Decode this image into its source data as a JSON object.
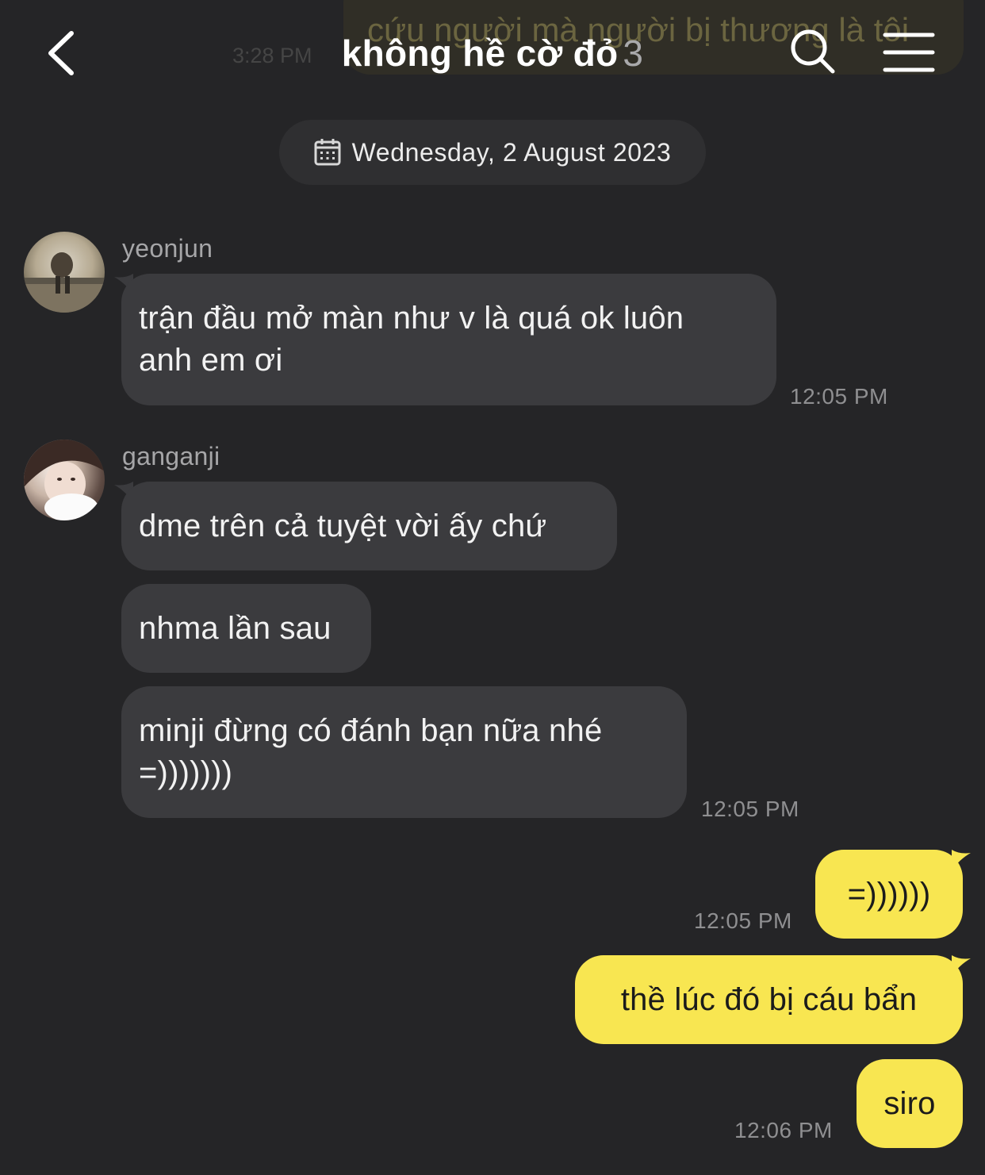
{
  "background_message": {
    "text": "cứu người mà người bị thương là tôi",
    "time": "3:28 PM"
  },
  "header": {
    "title": "không hề cờ đỏ",
    "member_count": "3"
  },
  "date_divider": {
    "label": "Wednesday, 2 August 2023"
  },
  "messages": [
    {
      "sender": "yeonjun",
      "text": "trận đầu mở màn như v là quá ok luôn anh em ơi",
      "line1": "trận đầu mở màn như v là quá ok luôn",
      "line2": "anh em ơi",
      "time": "12:05 PM"
    },
    {
      "sender": "ganganji",
      "text": "dme trên cả tuyệt vời ấy chứ"
    },
    {
      "sender": "ganganji",
      "text": "nhma lần sau"
    },
    {
      "sender": "ganganji",
      "line1": "minji đừng có đánh bạn nữa nhé",
      "line2": "=)))))))",
      "time": "12:05 PM"
    },
    {
      "sender": "me",
      "text": "=))))))",
      "time": "12:05 PM"
    },
    {
      "sender": "me",
      "text": "thề lúc đó bị cáu bẩn"
    },
    {
      "sender": "me",
      "text": "siro",
      "time": "12:06 PM"
    }
  ],
  "colors": {
    "background": "#252527",
    "incoming_bubble": "#3b3b3e",
    "outgoing_bubble": "#f8e651"
  },
  "icons": [
    "back-chevron-icon",
    "search-icon",
    "menu-icon",
    "calendar-icon"
  ]
}
